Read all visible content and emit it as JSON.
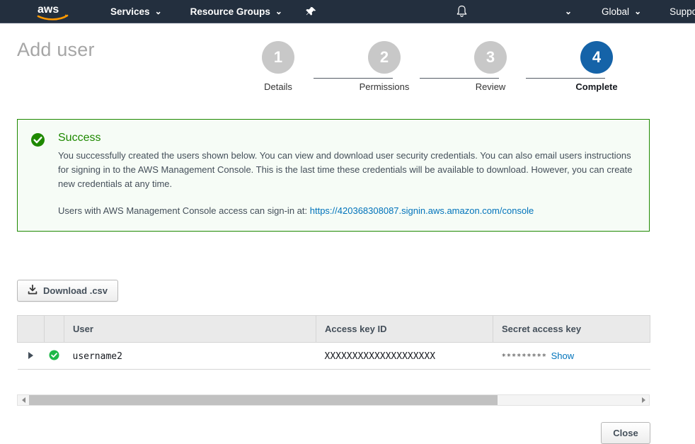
{
  "navbar": {
    "logo_alt": "aws-logo",
    "services_label": "Services",
    "resource_groups_label": "Resource Groups",
    "pin_icon": "pushpin-icon",
    "bell_icon": "bell-icon",
    "account_label": "",
    "global_label": "Global",
    "support_label": "Support",
    "background": "#232f3e"
  },
  "page": {
    "title": "Add user"
  },
  "steps": {
    "items": [
      {
        "number": "1",
        "label": "Details",
        "active": false
      },
      {
        "number": "2",
        "label": "Permissions",
        "active": false
      },
      {
        "number": "3",
        "label": "Review",
        "active": false
      },
      {
        "number": "4",
        "label": "Complete",
        "active": true
      }
    ],
    "active_color": "#1563a8",
    "inactive_color": "#c8c8c8"
  },
  "alert": {
    "icon": "check-circle-icon",
    "title": "Success",
    "body": "You successfully created the users shown below. You can view and download user security credentials. You can also email users instructions for signing in to the AWS Management Console. This is the last time these credentials will be available to download. However, you can create new credentials at any time.",
    "signin_prefix": "Users with AWS Management Console access can sign-in at:",
    "signin_url": "https://420368308087.signin.aws.amazon.com/console",
    "border_color": "#1e8900",
    "background": "#f6fcf6",
    "title_color": "#1e8900"
  },
  "toolbar": {
    "download_label": "Download .csv",
    "download_icon": "download-icon"
  },
  "table": {
    "headers": [
      "",
      "",
      "User",
      "Access key ID",
      "Secret access key"
    ],
    "rows": [
      {
        "expand_icon": "expand-triangle-icon",
        "status_icon": "check-circle-icon",
        "user": "username2",
        "access_key_id": "XXXXXXXXXXXXXXXXXXXX",
        "secret_mask": "*********",
        "secret_show_label": "Show"
      }
    ]
  },
  "scrollbar": {
    "left_arrow_icon": "arrow-left-icon",
    "right_arrow_icon": "arrow-right-icon",
    "thumb_fraction": "77%"
  },
  "footer": {
    "close_label": "Close"
  }
}
